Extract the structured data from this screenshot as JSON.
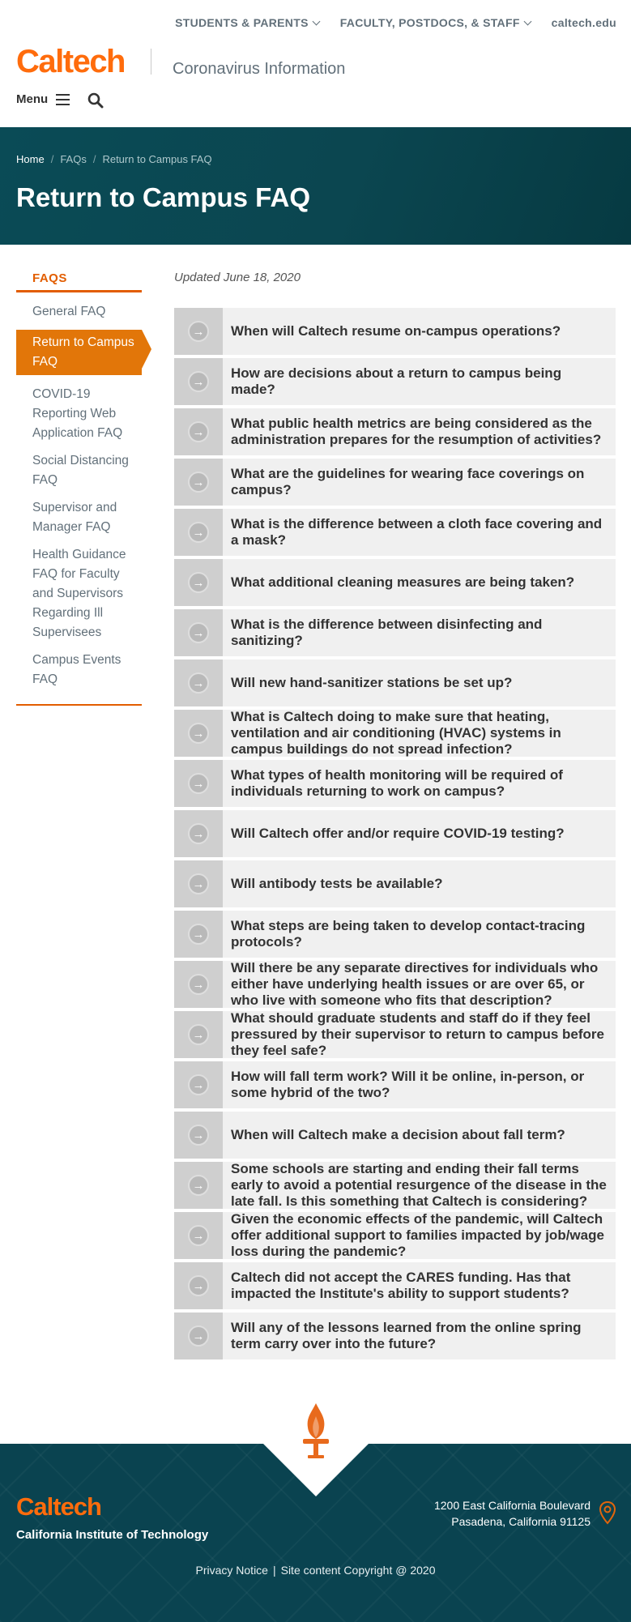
{
  "utility_nav": {
    "items": [
      {
        "label": "STUDENTS & PARENTS"
      },
      {
        "label": "FACULTY, POSTDOCS, & STAFF"
      },
      {
        "label": "caltech.edu"
      }
    ]
  },
  "header": {
    "logo": "Caltech",
    "site_name": "Coronavirus Information",
    "menu_label": "Menu"
  },
  "hero": {
    "breadcrumb": [
      "Home",
      "FAQs",
      "Return to Campus FAQ"
    ],
    "title": "Return to Campus FAQ"
  },
  "sidebar": {
    "title": "FAQS",
    "items": [
      {
        "label": "General FAQ"
      },
      {
        "label": "Return to Campus FAQ"
      },
      {
        "label": "COVID-19 Reporting Web Application FAQ"
      },
      {
        "label": "Social Distancing FAQ"
      },
      {
        "label": "Supervisor and Manager FAQ"
      },
      {
        "label": "Health Guidance FAQ for Faculty and Supervisors Regarding Ill Supervisees"
      },
      {
        "label": "Campus Events FAQ"
      }
    ]
  },
  "main": {
    "updated": "Updated June 18, 2020",
    "faqs": [
      "When will Caltech resume on-campus operations?",
      "How are decisions about a return to campus being made?",
      "What public health metrics are being considered as the administration prepares for the resumption of activities?",
      "What are the guidelines for wearing face coverings on campus?",
      "What is the difference between a cloth face covering and a mask?",
      "What additional cleaning measures are being taken?",
      "What is the difference between disinfecting and sanitizing?",
      "Will new hand-sanitizer stations be set up?",
      "What is Caltech doing to make sure that heating, ventilation and air conditioning (HVAC) systems in campus buildings do not spread infection?",
      "What types of health monitoring will be required of individuals returning to work on campus?",
      "Will Caltech offer and/or require COVID-19 testing?",
      "Will antibody tests be available?",
      "What steps are being taken to develop contact-tracing protocols?",
      "Will there be any separate directives for individuals who either have underlying health issues or are over 65, or who live with someone who fits that description?",
      "What should graduate students and staff do if they feel pressured by their supervisor to return to campus before they feel safe?",
      "How will fall term work? Will it be online, in-person, or some hybrid of the two?",
      "When will Caltech make a decision about fall term?",
      "Some schools are starting and ending their fall terms early to avoid a potential resurgence of the disease in the late fall. Is this something that Caltech is considering?",
      "Given the economic effects of the pandemic, will Caltech offer additional support to families impacted by job/wage loss during the pandemic?",
      "Caltech did not accept the CARES funding. Has that impacted the Institute's ability to support students?",
      "Will any of the lessons learned from the online spring term carry over into the future?"
    ]
  },
  "footer": {
    "logo": "Caltech",
    "institute": "California Institute of Technology",
    "address_line1": "1200 East California Boulevard",
    "address_line2": "Pasadena, California 91125",
    "privacy": "Privacy Notice",
    "separator": "|",
    "copyright": "Site content Copyright @ 2020"
  },
  "colors": {
    "brand_orange": "#ff6c0c",
    "hero_teal": "#0a4b56",
    "active_nav": "#e27609"
  }
}
